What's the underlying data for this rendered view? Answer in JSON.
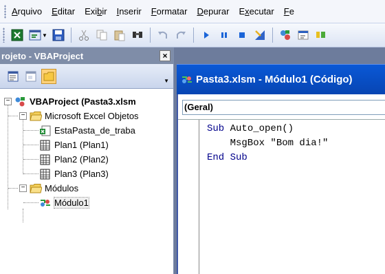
{
  "menubar": {
    "items": [
      {
        "label": "Arquivo",
        "accel": "A",
        "rest": "rquivo"
      },
      {
        "label": "Editar",
        "accel": "E",
        "rest": "ditar"
      },
      {
        "label": "Exibir",
        "pre": "Exi",
        "accel": "b",
        "rest": "ir"
      },
      {
        "label": "Inserir",
        "accel": "I",
        "rest": "nserir"
      },
      {
        "label": "Formatar",
        "accel": "F",
        "rest": "ormatar"
      },
      {
        "label": "Depurar",
        "accel": "D",
        "rest": "epurar"
      },
      {
        "label": "Executar",
        "pre": "E",
        "accel": "x",
        "rest": "ecutar"
      },
      {
        "label": "Fe",
        "accel": "F",
        "rest": "e"
      }
    ]
  },
  "toolbar": {
    "icons": [
      "excel-icon",
      "insert-module-icon",
      "save-icon",
      "cut-icon",
      "copy-icon",
      "paste-icon",
      "find-icon",
      "undo-icon",
      "redo-icon",
      "run-icon",
      "break-icon",
      "reset-icon",
      "design-mode-icon",
      "project-explorer-icon",
      "properties-icon",
      "object-browser-icon"
    ]
  },
  "project": {
    "title": "rojeto - VBAProject",
    "close": "×",
    "tree": {
      "root": "VBAProject (Pasta3.xlsm",
      "excel_objects": "Microsoft Excel Objetos",
      "workbook": "EstaPasta_de_traba",
      "sheet1": "Plan1 (Plan1)",
      "sheet2": "Plan2 (Plan2)",
      "sheet3": "Plan3 (Plan3)",
      "modules": "Módulos",
      "module1": "Módulo1"
    }
  },
  "codewindow": {
    "title": "Pasta3.xlsm - Módulo1 (Código)",
    "combo": "(Geral)",
    "code": {
      "line1_kw": "Sub",
      "line1_rest": " Auto_open()",
      "line2": "    MsgBox \"Bom dia!\"",
      "line3_kw": "End Sub"
    }
  }
}
